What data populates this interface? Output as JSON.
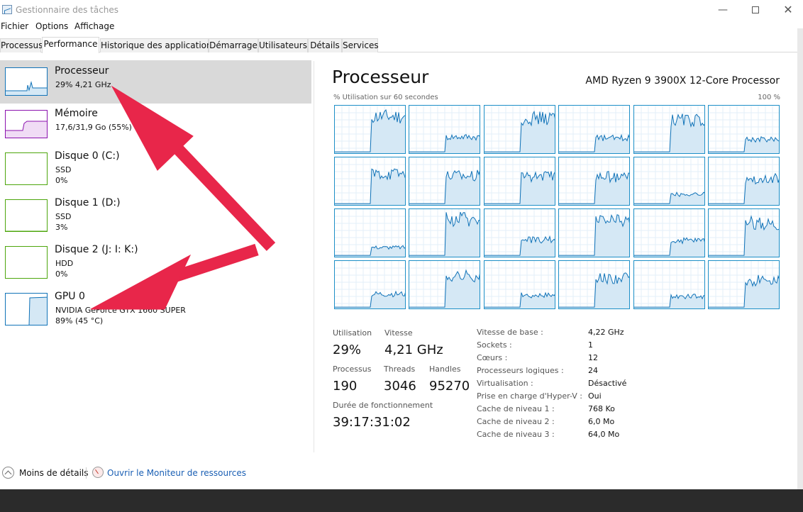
{
  "window": {
    "title": "Gestionnaire des tâches",
    "minimize": "—",
    "close": "✕"
  },
  "menu": [
    "Fichier",
    "Options",
    "Affichage"
  ],
  "tabs": [
    "Processus",
    "Performance",
    "Historique des applications",
    "Démarrage",
    "Utilisateurs",
    "Détails",
    "Services"
  ],
  "active_tab": "Performance",
  "resources": [
    {
      "name": "Processeur",
      "line1": "29% 4,21 GHz",
      "line2": "",
      "color": "#1173b8",
      "selected": true
    },
    {
      "name": "Mémoire",
      "line1": "17,6/31,9 Go (55%)",
      "line2": "",
      "color": "#8b12ae"
    },
    {
      "name": "Disque 0 (C:)",
      "line1": "SSD",
      "line2": "0%",
      "color": "#4da60c"
    },
    {
      "name": "Disque 1 (D:)",
      "line1": "SSD",
      "line2": "3%",
      "color": "#4da60c"
    },
    {
      "name": "Disque 2 (J: I: K:)",
      "line1": "HDD",
      "line2": "0%",
      "color": "#4da60c"
    },
    {
      "name": "GPU 0",
      "line1": "NVIDIA GeForce GTX 1660 SUPER",
      "line2": "89% (45 °C)",
      "color": "#1173b8"
    }
  ],
  "main": {
    "title": "Processeur",
    "model": "AMD Ryzen 9 3900X 12-Core Processor",
    "graph_label": "% Utilisation sur 60 secondes",
    "graph_max": "100 %",
    "core_count": 24,
    "stats": {
      "utilisation_label": "Utilisation",
      "utilisation": "29%",
      "vitesse_label": "Vitesse",
      "vitesse": "4,21 GHz",
      "processus_label": "Processus",
      "processus": "190",
      "threads_label": "Threads",
      "threads": "3046",
      "handles_label": "Handles",
      "handles": "95270",
      "uptime_label": "Durée de fonctionnement",
      "uptime": "39:17:31:02"
    },
    "specs": [
      {
        "label": "Vitesse de base :",
        "value": "4,22 GHz"
      },
      {
        "label": "Sockets :",
        "value": "1"
      },
      {
        "label": "Cœurs :",
        "value": "12"
      },
      {
        "label": "Processeurs logiques :",
        "value": "24"
      },
      {
        "label": "Virtualisation :",
        "value": "Désactivé"
      },
      {
        "label": "Prise en charge d'Hyper-V :",
        "value": "Oui"
      },
      {
        "label": "Cache de niveau 1 :",
        "value": "768 Ko"
      },
      {
        "label": "Cache de niveau 2 :",
        "value": "6,0 Mo"
      },
      {
        "label": "Cache de niveau 3 :",
        "value": "64,0 Mo"
      }
    ]
  },
  "footer": {
    "less_details": "Moins de détails",
    "resource_monitor": "Ouvrir le Moniteur de ressources"
  },
  "colors": {
    "cpu_line": "#1173b8",
    "cpu_fill": "#d5e8f5",
    "annotation_arrow": "#e8264a"
  }
}
